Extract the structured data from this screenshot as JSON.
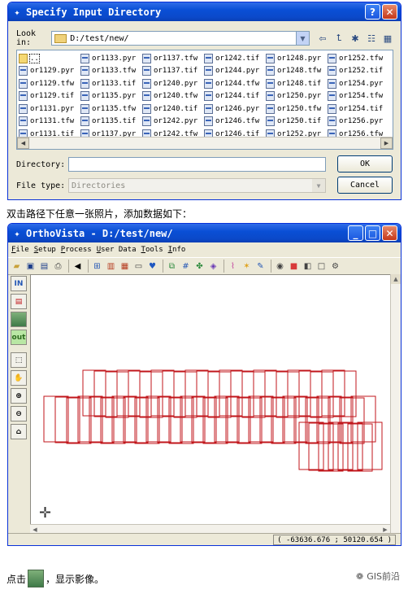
{
  "dialog": {
    "title": "Specify Input Directory",
    "help_label": "?",
    "close_label": "✕",
    "lookin_label": "Look in:",
    "lookin_value": "D:/test/new/",
    "files": [
      {
        "name": "..",
        "type": "folder"
      },
      {
        "name": "or1129.pyr",
        "type": "file"
      },
      {
        "name": "or1129.tfw",
        "type": "file"
      },
      {
        "name": "or1129.tif",
        "type": "file"
      },
      {
        "name": "or1131.pyr",
        "type": "file"
      },
      {
        "name": "or1131.tfw",
        "type": "file"
      },
      {
        "name": "or1131.tif",
        "type": "file"
      },
      {
        "name": "or1133.pyr",
        "type": "file"
      },
      {
        "name": "or1133.tfw",
        "type": "file"
      },
      {
        "name": "or1133.tif",
        "type": "file"
      },
      {
        "name": "or1135.pyr",
        "type": "file"
      },
      {
        "name": "or1135.tfw",
        "type": "file"
      },
      {
        "name": "or1135.tif",
        "type": "file"
      },
      {
        "name": "or1137.pyr",
        "type": "file"
      },
      {
        "name": "or1137.tfw",
        "type": "file"
      },
      {
        "name": "or1137.tif",
        "type": "file"
      },
      {
        "name": "or1240.pyr",
        "type": "file"
      },
      {
        "name": "or1240.tfw",
        "type": "file"
      },
      {
        "name": "or1240.tif",
        "type": "file"
      },
      {
        "name": "or1242.pyr",
        "type": "file"
      },
      {
        "name": "or1242.tfw",
        "type": "file"
      },
      {
        "name": "or1242.tif",
        "type": "file"
      },
      {
        "name": "or1244.pyr",
        "type": "file"
      },
      {
        "name": "or1244.tfw",
        "type": "file"
      },
      {
        "name": "or1244.tif",
        "type": "file"
      },
      {
        "name": "or1246.pyr",
        "type": "file"
      },
      {
        "name": "or1246.tfw",
        "type": "file"
      },
      {
        "name": "or1246.tif",
        "type": "file"
      },
      {
        "name": "or1248.pyr",
        "type": "file"
      },
      {
        "name": "or1248.tfw",
        "type": "file"
      },
      {
        "name": "or1248.tif",
        "type": "file"
      },
      {
        "name": "or1250.pyr",
        "type": "file"
      },
      {
        "name": "or1250.tfw",
        "type": "file"
      },
      {
        "name": "or1250.tif",
        "type": "file"
      },
      {
        "name": "or1252.pyr",
        "type": "file"
      },
      {
        "name": "or1252.tfw",
        "type": "file"
      },
      {
        "name": "or1252.tif",
        "type": "file"
      },
      {
        "name": "or1254.pyr",
        "type": "file"
      },
      {
        "name": "or1254.tfw",
        "type": "file"
      },
      {
        "name": "or1254.tif",
        "type": "file"
      },
      {
        "name": "or1256.pyr",
        "type": "file"
      },
      {
        "name": "or1256.tfw",
        "type": "file"
      }
    ],
    "directory_label": "Directory:",
    "directory_value": "",
    "filetype_label": "File type:",
    "filetype_value": "Directories",
    "ok_label": "OK",
    "cancel_label": "Cancel"
  },
  "caption1": "双击路径下任意一张照片，添加数据如下：",
  "ortho": {
    "title": "OrthoVista - D:/test/new/",
    "menus": [
      "File",
      "Setup",
      "Process",
      "User Data",
      "Tools",
      "Info"
    ],
    "coordinate_readout": "( -63636.676 ; 50120.654 )",
    "footprint_color": "#c0161b"
  },
  "caption2_before": "点击",
  "caption2_after": "，显示影像。",
  "watermark": "GIS前沿"
}
